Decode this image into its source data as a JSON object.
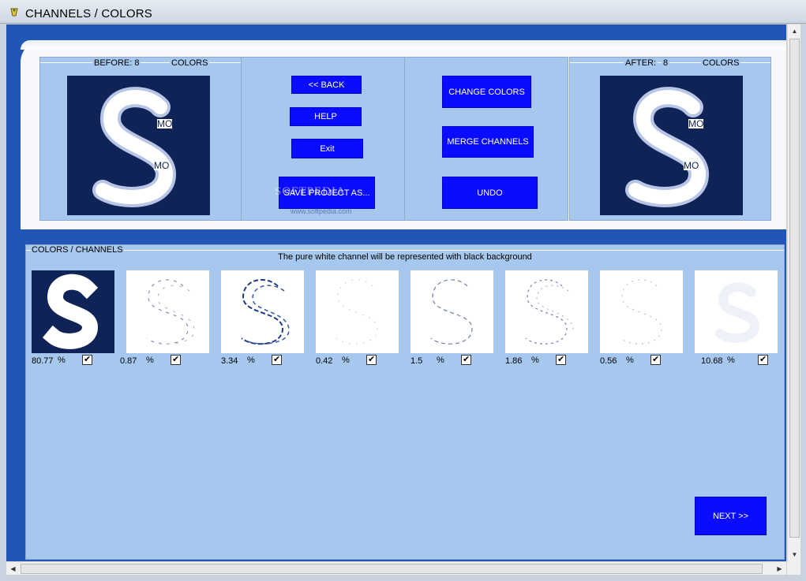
{
  "window": {
    "title": "CHANNELS / COLORS",
    "icon": "app-icon"
  },
  "before": {
    "label": "BEFORE: 8",
    "colors_label": "COLORS",
    "overlay_texts": [
      "MO",
      "MO"
    ]
  },
  "after": {
    "label": "AFTER:",
    "count": "8",
    "colors_label": "COLORS",
    "overlay_texts": [
      "MO",
      "MO"
    ]
  },
  "buttons": {
    "back": "<< BACK",
    "help": "HELP",
    "exit": "Exit",
    "save_project": "SAVE PROJECT AS...",
    "change_colors": "CHANGE COLORS",
    "merge_channels": "MERGE CHANNELS",
    "undo": "UNDO",
    "next": "NEXT >>"
  },
  "watermark": {
    "main": "SOFTPEDIA",
    "sub": "www.softpedia.com"
  },
  "channels_panel": {
    "title": "COLORS / CHANNELS",
    "note": "The pure white channel will be represented with black background",
    "channels": [
      {
        "percent": "80.77",
        "sign": "%",
        "checked": true,
        "dark": true
      },
      {
        "percent": "0.87",
        "sign": "%",
        "checked": true,
        "dark": false
      },
      {
        "percent": "3.34",
        "sign": "%",
        "checked": true,
        "dark": false
      },
      {
        "percent": "0.42",
        "sign": "%",
        "checked": true,
        "dark": false
      },
      {
        "percent": "1.5",
        "sign": "%",
        "checked": true,
        "dark": false
      },
      {
        "percent": "1.86",
        "sign": "%",
        "checked": true,
        "dark": false
      },
      {
        "percent": "0.56",
        "sign": "%",
        "checked": true,
        "dark": false
      },
      {
        "percent": "10.68",
        "sign": "%",
        "checked": true,
        "dark": false
      }
    ]
  },
  "colors": {
    "accent_button": "#0a0cff",
    "panel": "#a7c8ee",
    "background": "#1f56b8",
    "preview_dark": "#0f2356"
  }
}
